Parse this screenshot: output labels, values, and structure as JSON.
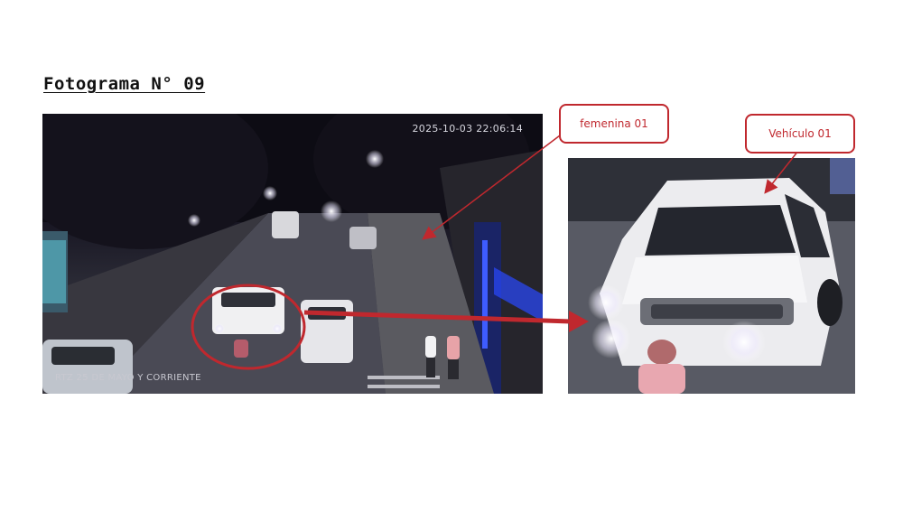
{
  "heading": "Fotograma N° 09",
  "main_frame": {
    "timestamp": "2025-10-03 22:06:14",
    "camera_label": "RTZ 25 DE MAYO Y CORRIENTE"
  },
  "callouts": {
    "femenina": "femenina 01",
    "vehiculo": "Vehículo 01"
  },
  "colors": {
    "annotation_red": "#c0282e"
  }
}
